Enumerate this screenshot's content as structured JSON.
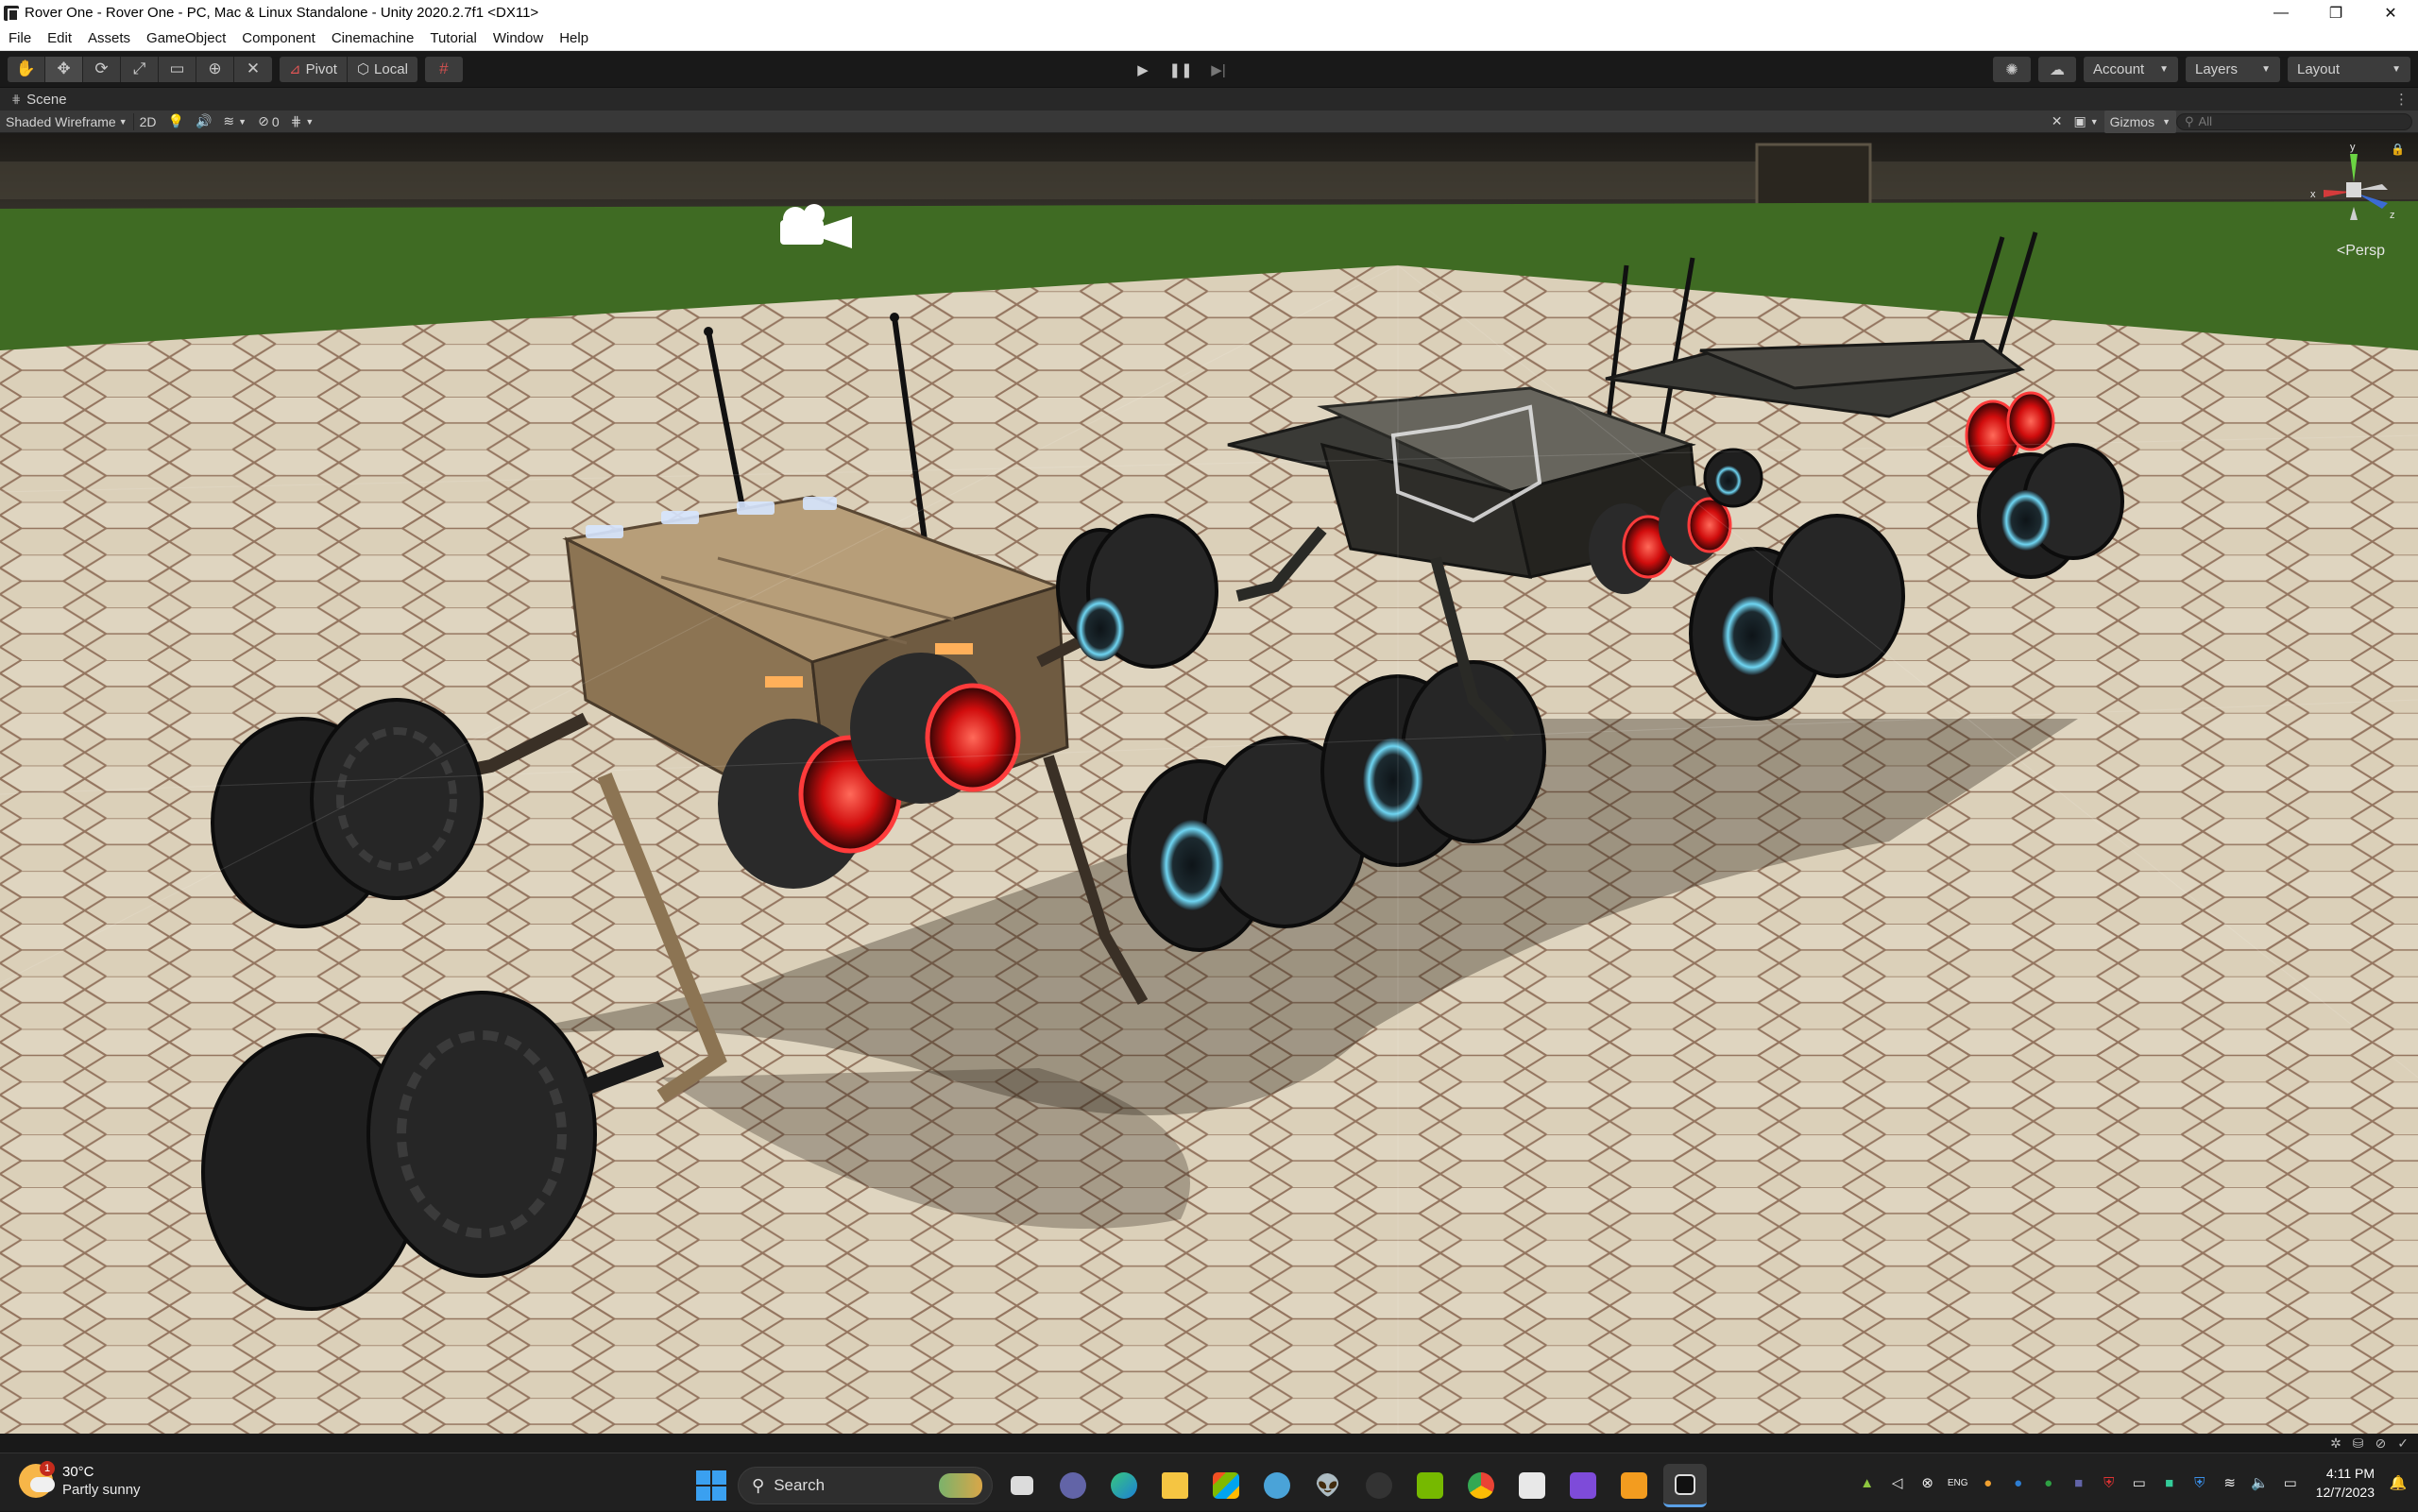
{
  "window": {
    "title": "Rover One - Rover One - PC, Mac & Linux Standalone - Unity 2020.2.7f1 <DX11>"
  },
  "menu": [
    "File",
    "Edit",
    "Assets",
    "GameObject",
    "Component",
    "Cinemachine",
    "Tutorial",
    "Window",
    "Help"
  ],
  "toolbar": {
    "pivot_label": "Pivot",
    "local_label": "Local",
    "account_label": "Account",
    "layers_label": "Layers",
    "layout_label": "Layout"
  },
  "scene": {
    "tab_label": "Scene",
    "draw_mode": "Shaded Wireframe",
    "mode_2d": "2D",
    "hidden_count": "0",
    "gizmos_label": "Gizmos",
    "search_placeholder": "All",
    "projection_label": "Persp",
    "axis_x": "x",
    "axis_y": "y",
    "axis_z": "z"
  },
  "taskbar": {
    "weather_temp": "30°C",
    "weather_condition": "Partly sunny",
    "weather_badge": "1",
    "search_label": "Search",
    "time": "4:11 PM",
    "date": "12/7/2023",
    "language": "ENG"
  },
  "colors": {
    "unity_bg": "#191919",
    "scene_toolbar": "#383838",
    "taskbar": "#202020",
    "grass": "#3f6b23",
    "tiles": "#d9cdb5",
    "thruster_glow": "#ff2020",
    "wheel_glow": "#4fc3e6"
  }
}
